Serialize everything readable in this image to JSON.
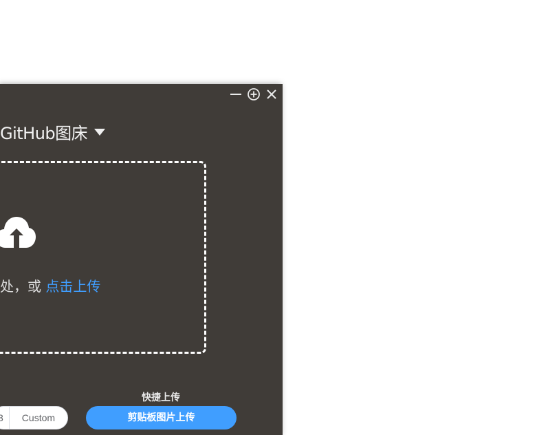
{
  "window": {
    "controls": {
      "minimize_icon": "minimize-icon",
      "zoom_icon": "zoom-in-icon",
      "close_icon": "close-icon"
    }
  },
  "header": {
    "title": "GitHub图床",
    "dropdown_icon": "caret-down-icon"
  },
  "upload": {
    "cloud_icon": "cloud-upload-icon",
    "drop_text": "处，或 ",
    "click_upload": "点击上传"
  },
  "footer": {
    "quick_label": "快捷上传",
    "format_options": [
      "3",
      "Custom"
    ],
    "clipboard_button": "剪贴板图片上传"
  },
  "colors": {
    "background": "#403c38",
    "accent": "#409eff",
    "page": "#ffffff"
  }
}
